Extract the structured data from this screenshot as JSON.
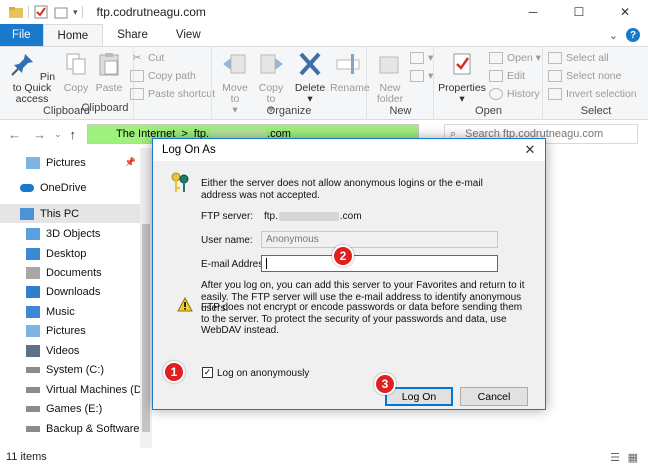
{
  "window": {
    "title": "ftp.codrutneagu.com",
    "min_icon": "minimize-icon",
    "max_icon": "maximize-icon",
    "close_icon": "close-icon"
  },
  "ribbon_tabs": [
    "File",
    "Home",
    "Share",
    "View"
  ],
  "ribbon": {
    "clipboard": {
      "label": "Clipboard",
      "pin": "Pin to Quick access",
      "copy": "Copy",
      "paste": "Paste",
      "cut": "Cut",
      "copy_path": "Copy path",
      "paste_shortcut": "Paste shortcut"
    },
    "organize": {
      "label": "Organize",
      "move_to": "Move to",
      "copy_to": "Copy to",
      "delete": "Delete",
      "rename": "Rename"
    },
    "new": {
      "label": "New",
      "new_folder": "New folder"
    },
    "open": {
      "label": "Open",
      "properties": "Properties",
      "open": "Open",
      "edit": "Edit",
      "history": "History"
    },
    "select": {
      "label": "Select",
      "select_all": "Select all",
      "select_none": "Select none",
      "invert_selection": "Invert selection"
    }
  },
  "address": {
    "crumb1": "The Internet",
    "crumb_sep": ">",
    "crumb2": "ftp.",
    "crumb2_end": ".com",
    "search_placeholder": "Search ftp.codrutneagu.com"
  },
  "nav": [
    {
      "label": "Pictures",
      "icon": "pictures-folder-icon"
    },
    {
      "label": "OneDrive",
      "icon": "onedrive-cloud-icon"
    },
    {
      "label": "This PC",
      "icon": "computer-icon",
      "selected": true
    },
    {
      "label": "3D Objects",
      "icon": "3d-objects-icon"
    },
    {
      "label": "Desktop",
      "icon": "desktop-folder-icon"
    },
    {
      "label": "Documents",
      "icon": "documents-folder-icon"
    },
    {
      "label": "Downloads",
      "icon": "downloads-folder-icon"
    },
    {
      "label": "Music",
      "icon": "music-folder-icon"
    },
    {
      "label": "Pictures",
      "icon": "pictures-folder-icon"
    },
    {
      "label": "Videos",
      "icon": "videos-folder-icon"
    },
    {
      "label": "System (C:)",
      "icon": "drive-icon"
    },
    {
      "label": "Virtual Machines (D:)",
      "icon": "drive-icon"
    },
    {
      "label": "Games (E:)",
      "icon": "drive-icon"
    },
    {
      "label": "Backup & Software (F:",
      "icon": "drive-icon"
    }
  ],
  "status": {
    "items": "11 items"
  },
  "dialog": {
    "title": "Log On As",
    "intro": "Either the server does not allow anonymous logins or the e-mail address was not accepted.",
    "ftp_server_label": "FTP server:",
    "ftp_server_prefix": "ftp.",
    "ftp_server_suffix": ".com",
    "user_name_label": "User name:",
    "user_name_value": "Anonymous",
    "email_label": "E-mail Address:",
    "email_value": "",
    "info": "After you log on, you can add this server to your Favorites and return to it easily. The FTP server will use the e-mail address to identify anonymous users.",
    "warning": "FTP does not encrypt or encode passwords or data before sending them to the server.  To protect the security of your passwords and data, use WebDAV instead.",
    "anon_label": "Log on anonymously",
    "anon_checked": true,
    "logon_button": "Log On",
    "cancel_button": "Cancel"
  },
  "callouts": [
    "1",
    "2",
    "3"
  ],
  "colors": {
    "accent": "#1979ca",
    "address_bg": "#9ff07d",
    "callout": "#e02020"
  }
}
